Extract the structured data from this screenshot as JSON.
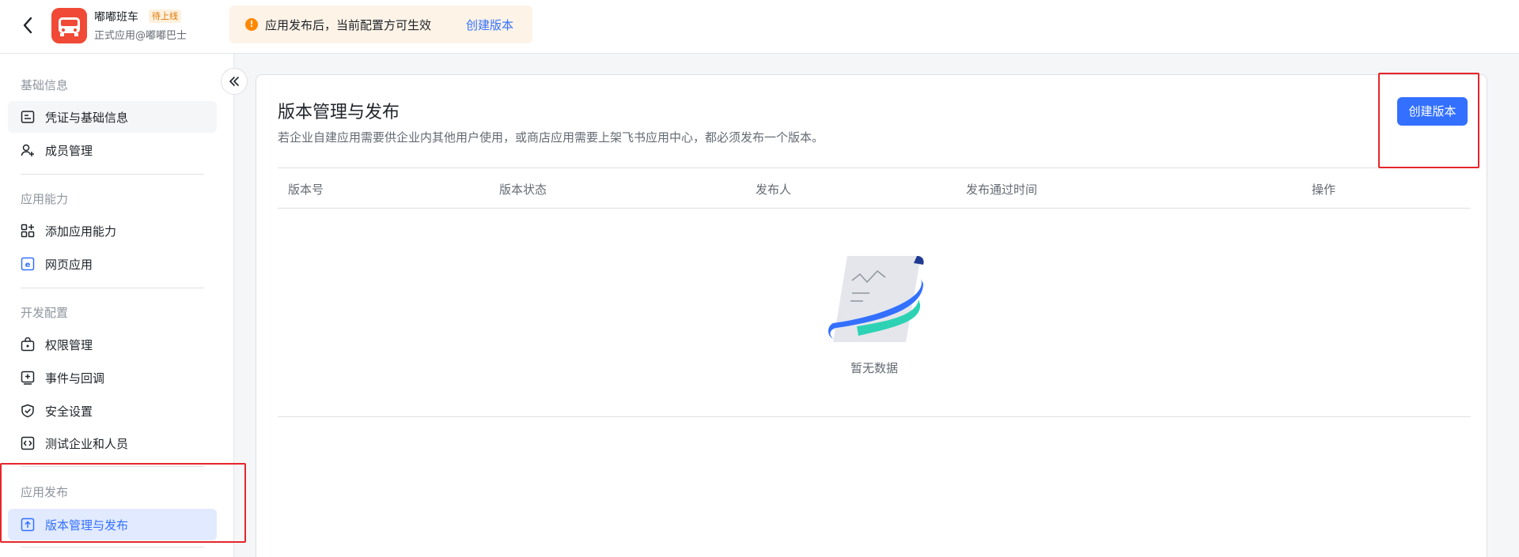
{
  "header": {
    "app_name": "嘟嘟班车",
    "app_badge": "待上线",
    "app_subtitle": "正式应用@嘟嘟巴士",
    "notice": {
      "text": "应用发布后，当前配置方可生效",
      "link": "创建版本"
    }
  },
  "sidebar": {
    "groups": [
      {
        "title": "基础信息",
        "items": [
          {
            "label": "凭证与基础信息",
            "icon": "credential-icon"
          },
          {
            "label": "成员管理",
            "icon": "member-add-icon"
          }
        ]
      },
      {
        "title": "应用能力",
        "items": [
          {
            "label": "添加应用能力",
            "icon": "add-capability-icon"
          },
          {
            "label": "网页应用",
            "icon": "web-app-icon"
          }
        ]
      },
      {
        "title": "开发配置",
        "items": [
          {
            "label": "权限管理",
            "icon": "permission-icon"
          },
          {
            "label": "事件与回调",
            "icon": "event-callback-icon"
          },
          {
            "label": "安全设置",
            "icon": "shield-icon"
          },
          {
            "label": "测试企业和人员",
            "icon": "code-icon"
          }
        ]
      },
      {
        "title": "应用发布",
        "items": [
          {
            "label": "版本管理与发布",
            "icon": "upload-icon",
            "active": true
          }
        ]
      }
    ]
  },
  "main": {
    "title": "版本管理与发布",
    "description": "若企业自建应用需要供企业内其他用户使用，或商店应用需要上架飞书应用中心，都必须发布一个版本。",
    "create_button": "创建版本",
    "table": {
      "columns": [
        "版本号",
        "版本状态",
        "发布人",
        "发布通过时间",
        "操作"
      ],
      "empty_text": "暂无数据"
    }
  },
  "colors": {
    "primary": "#3370ff",
    "active_bg": "#e1eaff",
    "highlight_red": "#e5262a",
    "notice_bg": "#fdf3e7",
    "logo_red": "#f04a37"
  }
}
